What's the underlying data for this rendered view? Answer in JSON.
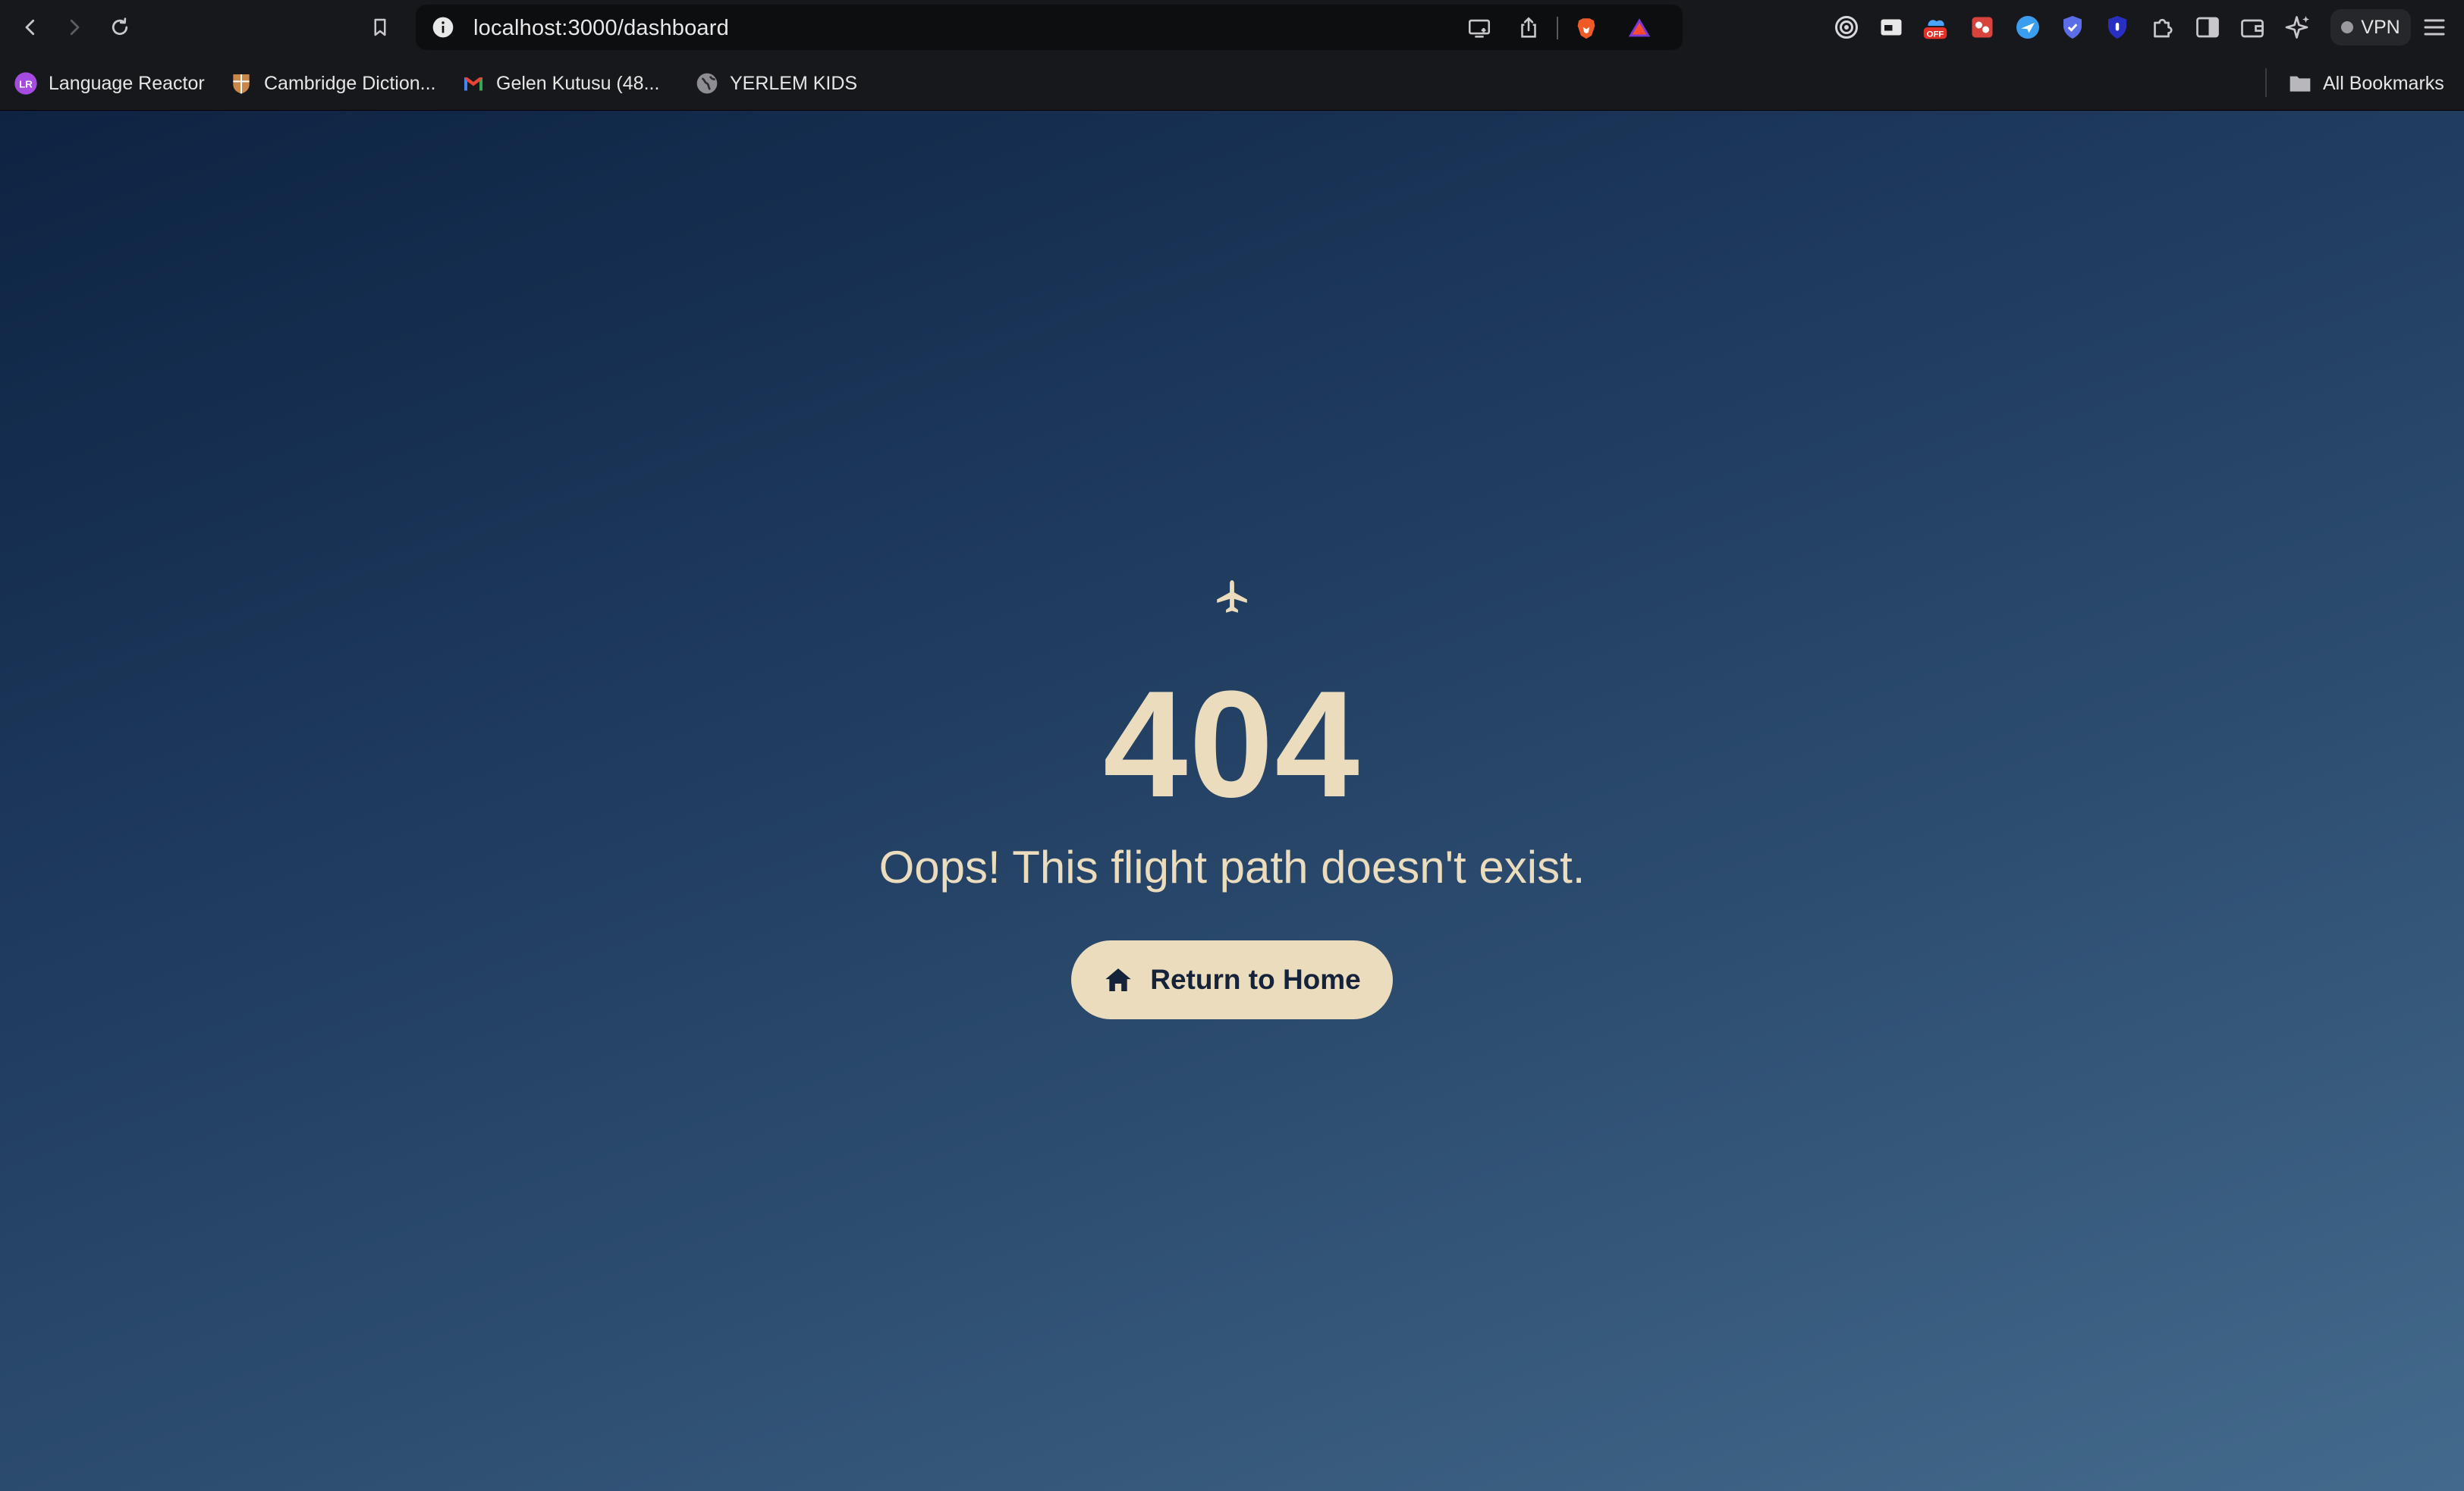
{
  "browser": {
    "url": "localhost:3000/dashboard",
    "vpn_label": "VPN",
    "extension_badge": "OFF",
    "bookmarks": [
      {
        "label": "Language Reactor",
        "icon": "language-reactor-icon"
      },
      {
        "label": "Cambridge Diction...",
        "icon": "cambridge-dictionary-icon"
      },
      {
        "label": "Gelen Kutusu (48...",
        "icon": "gmail-icon"
      },
      {
        "label": "YERLEM KIDS",
        "icon": "globe-icon"
      }
    ],
    "all_bookmarks_label": "All Bookmarks"
  },
  "page": {
    "icon": "airplane-icon",
    "error_code": "404",
    "message": "Oops! This flight path doesn't exist.",
    "home_button_label": "Return to Home",
    "home_button_icon": "home-icon"
  },
  "colors": {
    "background_start": "#0d2342",
    "background_end": "#436a8c",
    "accent": "#eadcbd",
    "button_text": "#14233a"
  }
}
